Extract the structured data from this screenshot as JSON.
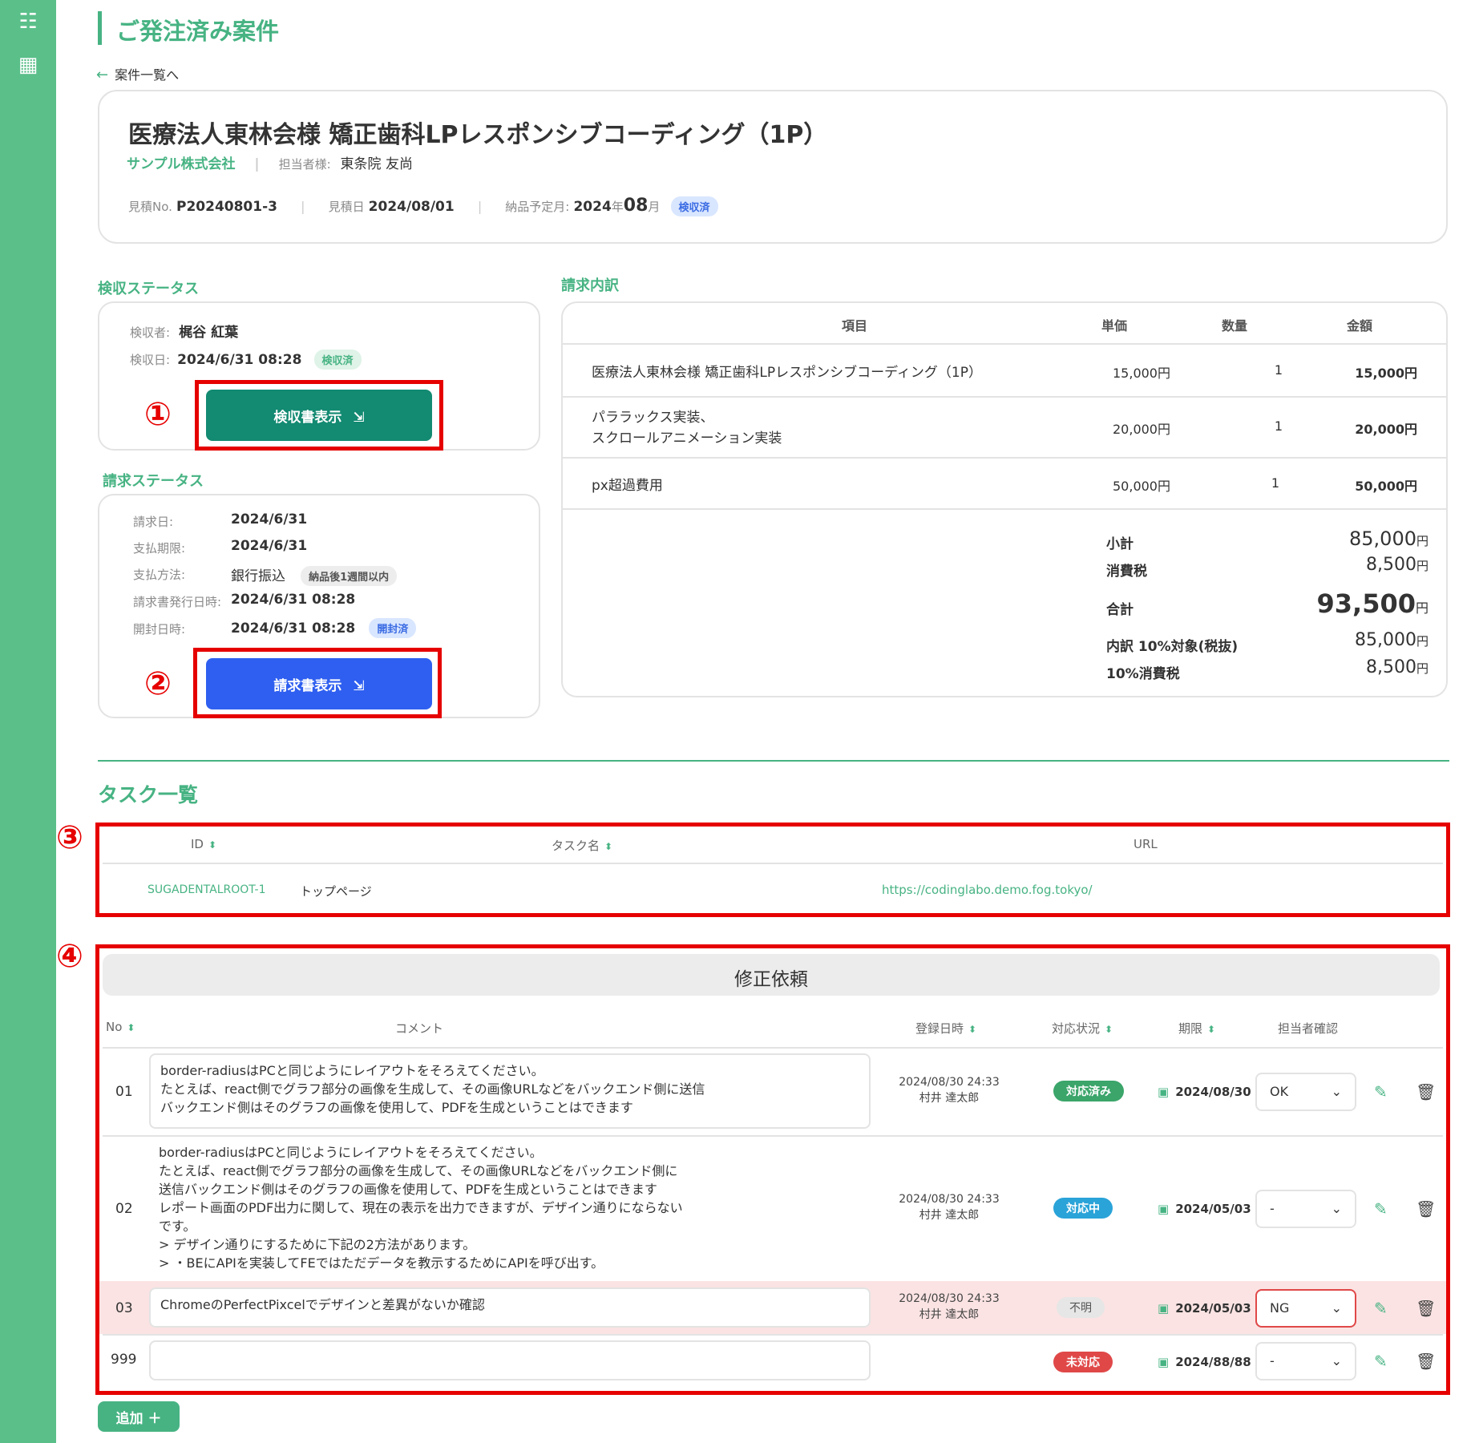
{
  "sidebar": {
    "icons": [
      "list-check-icon",
      "calculator-icon"
    ]
  },
  "page_title": "ご発注済み案件",
  "back_link": "案件一覧へ",
  "project": {
    "title": "医療法人東林会様 矯正歯科LPレスポンシブコーディング（1P）",
    "client": "サンプル株式会社",
    "contact_label": "担当者様:",
    "contact_name": "東条院 友尚",
    "estimate_no_label": "見積No.",
    "estimate_no": "P20240801-3",
    "estimate_date_label": "見積日",
    "estimate_date": "2024/08/01",
    "delivery_label": "納品予定月:",
    "delivery_year": "2024",
    "year_unit": "年",
    "delivery_month": "08",
    "month_unit": "月",
    "delivery_badge": "検収済"
  },
  "inspection": {
    "section_label": "検収ステータス",
    "inspector_label": "検収者:",
    "inspector": "梶谷 紅葉",
    "date_label": "検収日:",
    "date": "2024/6/31 08:28",
    "badge": "検収済",
    "button": "検収書表示",
    "marker": "①"
  },
  "billing": {
    "section_label": "請求ステータス",
    "rows": [
      {
        "label": "請求日:",
        "value": "2024/6/31"
      },
      {
        "label": "支払期限:",
        "value": "2024/6/31"
      },
      {
        "label": "支払方法:",
        "value": "銀行振込",
        "badge": "納品後1週間以内"
      },
      {
        "label": "請求書発行日時:",
        "value": "2024/6/31 08:28"
      },
      {
        "label": "開封日時:",
        "value": "2024/6/31 08:28",
        "badge": "開封済"
      }
    ],
    "button": "請求書表示",
    "marker": "②"
  },
  "invoice": {
    "section_label": "請求内訳",
    "headers": [
      "項目",
      "単価",
      "数量",
      "金額"
    ],
    "items": [
      {
        "name": "医療法人東林会様 矯正歯科LPレスポンシブコーディング（1P）",
        "price": "15,000円",
        "qty": "1",
        "amount": "15,000円"
      },
      {
        "name_line1": "パララックス実装、",
        "name_line2": "スクロールアニメーション実装",
        "price": "20,000円",
        "qty": "1",
        "amount": "20,000円"
      },
      {
        "name": "px超過費用",
        "price": "50,000円",
        "qty": "1",
        "amount": "50,000円"
      }
    ],
    "subtotal_label": "小計",
    "subtotal": "85,000",
    "tax_label": "消費税",
    "tax": "8,500",
    "total_label": "合計",
    "total": "93,500",
    "breakdown_label": "内訳 10%対象(税抜)",
    "breakdown": "85,000",
    "breakdown_tax_label": "10%消費税",
    "breakdown_tax": "8,500",
    "yen": "円"
  },
  "tasks": {
    "section_label": "タスク一覧",
    "marker": "③",
    "headers": [
      "ID",
      "タスク名",
      "URL"
    ],
    "rows": [
      {
        "id": "SUGADENTALROOT-1",
        "name": "トップページ",
        "url": "https://codinglabo.demo.fog.tokyo/"
      }
    ]
  },
  "revisions": {
    "title": "修正依頼",
    "marker": "④",
    "headers": [
      "No",
      "コメント",
      "登録日時",
      "対応状況",
      "期限",
      "担当者確認"
    ],
    "rows": [
      {
        "no": "01",
        "comment_lines": [
          "border-radiusはPCと同じようにレイアウトをそろえてください。",
          "たとえば、react側でグラフ部分の画像を生成して、その画像URLなどをバックエンド側に送信",
          "バックエンド側はそのグラフの画像を使用して、PDFを生成ということはできます"
        ],
        "reg_date": "2024/08/30 24:33",
        "reg_user": "村井 達太郎",
        "status": "対応済み",
        "status_color": "#3ba56a",
        "deadline": "2024/08/30",
        "confirm": "OK"
      },
      {
        "no": "02",
        "comment_lines": [
          "border-radiusはPCと同じようにレイアウトをそろえてください。",
          "たとえば、react側でグラフ部分の画像を生成して、その画像URLなどをバックエンド側に",
          "送信バックエンド側はそのグラフの画像を使用して、PDFを生成ということはできます",
          "レポート画面のPDF出力に関して、現在の表示を出力できますが、デザイン通りにならない",
          "です。",
          "> デザイン通りにするために下記の2方法があります。",
          "> ・BEにAPIを実装してFEではただデータを教示するためにAPIを呼び出す。"
        ],
        "reg_date": "2024/08/30 24:33",
        "reg_user": "村井 達太郎",
        "status": "対応中",
        "status_color": "#2aa3d8",
        "deadline": "2024/05/03",
        "confirm": "-"
      },
      {
        "no": "03",
        "comment_lines": [
          "ChromeのPerfectPixcelでデザインと差異がないか確認"
        ],
        "reg_date": "2024/08/30 24:33",
        "reg_user": "村井 達太郎",
        "status": "不明",
        "status_color": "#e6e6e6",
        "deadline": "2024/05/03",
        "confirm": "NG"
      },
      {
        "no": "999",
        "comment_lines": [
          ""
        ],
        "reg_date": "",
        "reg_user": "",
        "status": "未対応",
        "status_color": "#e04848",
        "deadline": "2024/88/88",
        "confirm": "-"
      }
    ]
  },
  "add_button": "追加 ＋",
  "colors": {
    "accent": "#47b383",
    "sidebar": "#5bbf8a",
    "highlight_box": "#e60000",
    "ng_row": "#fbe3e3"
  }
}
